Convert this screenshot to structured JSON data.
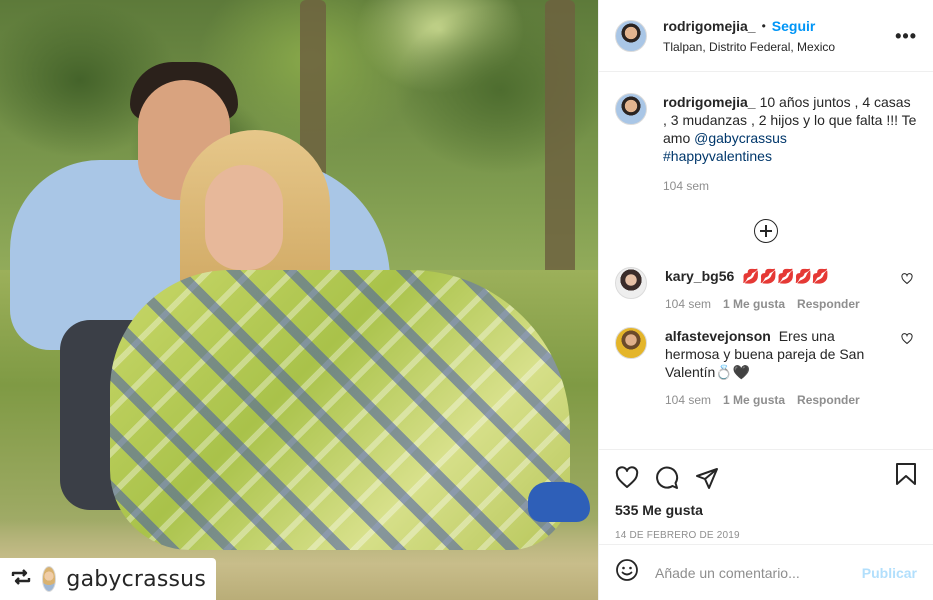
{
  "photo": {
    "repost_icon": "repost-icon",
    "repost_username": "gabycrassus"
  },
  "header": {
    "username": "rodrigomejia_",
    "separator": "•",
    "follow_label": "Seguir",
    "location": "Tlalpan, Distrito Federal, Mexico",
    "more_label": "•••"
  },
  "caption": {
    "username": "rodrigomejia_",
    "text": "10 años juntos , 4 casas , 3 mudanzas , 2 hijos y lo que falta !!! Te amo ",
    "mention": "@gabycrassus",
    "hashtag": "#happyvalentines",
    "time": "104 sem"
  },
  "comments": [
    {
      "username": "kary_bg56",
      "text": "💋💋💋💋💋",
      "time": "104 sem",
      "likes": "1 Me gusta",
      "reply": "Responder"
    },
    {
      "username": "alfastevejonson",
      "text": "Eres una hermosa y buena pareja de San Valentín💍🖤",
      "time": "104 sem",
      "likes": "1 Me gusta",
      "reply": "Responder"
    }
  ],
  "actions": {
    "likes": "535 Me gusta",
    "date": "14 DE FEBRERO DE 2019"
  },
  "add_comment": {
    "placeholder": "Añade un comentario...",
    "publish_label": "Publicar"
  },
  "colors": {
    "accent": "#0095f6",
    "publish_disabled": "#b2dffc",
    "muted": "#8e8e8e",
    "link": "#00376b"
  }
}
